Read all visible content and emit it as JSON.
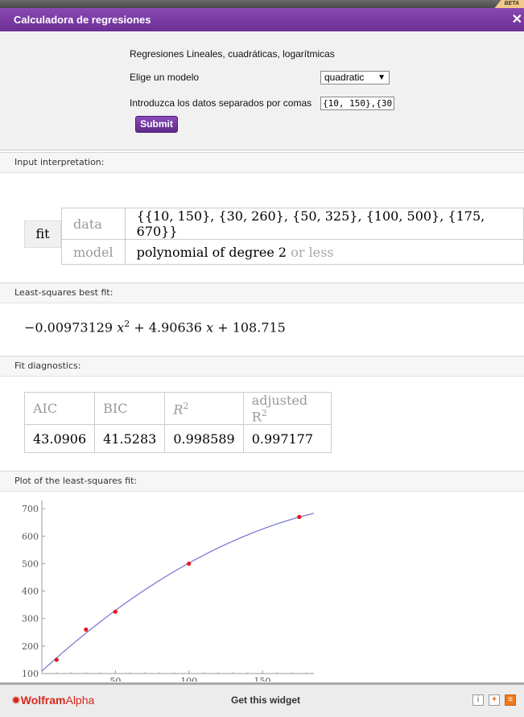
{
  "beta_badge": "BETA",
  "title": "Calculadora de regresiones",
  "close_icon": "close-icon",
  "form": {
    "heading": "Regresiones Lineales, cuadráticas, logarítmicas",
    "model_label": "Elige un modelo",
    "model_value": "quadratic",
    "data_label": "Introduzca los datos separados por comas",
    "data_value": "{10, 150},{30,",
    "submit_label": "Submit"
  },
  "input_interp": {
    "header": "Input interpretation:",
    "fit_label": "fit",
    "data_key": "data",
    "data_value": "{{10, 150}, {30, 260}, {50, 325}, {100, 500}, {175, 670}}",
    "model_key": "model",
    "model_value": "polynomial of degree 2",
    "model_suffix": "or less"
  },
  "best_fit": {
    "header": "Least-squares best fit:",
    "coef_a": "−0.00973129",
    "coef_b": "+ 4.90636",
    "coef_c": "+ 108.715"
  },
  "diagnostics": {
    "header": "Fit diagnostics:",
    "aic_label": "AIC",
    "bic_label": "BIC",
    "r2_label": "R",
    "adj_r2_label": "adjusted R",
    "aic": "43.0906",
    "bic": "41.5283",
    "r2": "0.998589",
    "adj_r2": "0.997177"
  },
  "plot_header": "Plot of the least-squares fit:",
  "chart_data": {
    "type": "scatter",
    "points": [
      [
        10,
        150
      ],
      [
        30,
        260
      ],
      [
        50,
        325
      ],
      [
        100,
        500
      ],
      [
        175,
        670
      ]
    ],
    "fit": {
      "a": -0.00973129,
      "b": 4.90636,
      "c": 108.715
    },
    "yticks": [
      100,
      200,
      300,
      400,
      500,
      600,
      700
    ],
    "xticks": [
      50,
      100,
      150
    ],
    "xlim": [
      0,
      185
    ],
    "ylim": [
      100,
      715
    ],
    "point_color": "#e8141a",
    "curve_color": "#7b7bd4"
  },
  "footer": {
    "logo_prefix": "Wolfram",
    "logo_suffix": "Alpha",
    "get_widget": "Get this widget",
    "icons": [
      "info-icon",
      "add-icon",
      "rss-icon"
    ],
    "info_glyph": "i",
    "add_glyph": "+",
    "rss_glyph": "≡"
  }
}
